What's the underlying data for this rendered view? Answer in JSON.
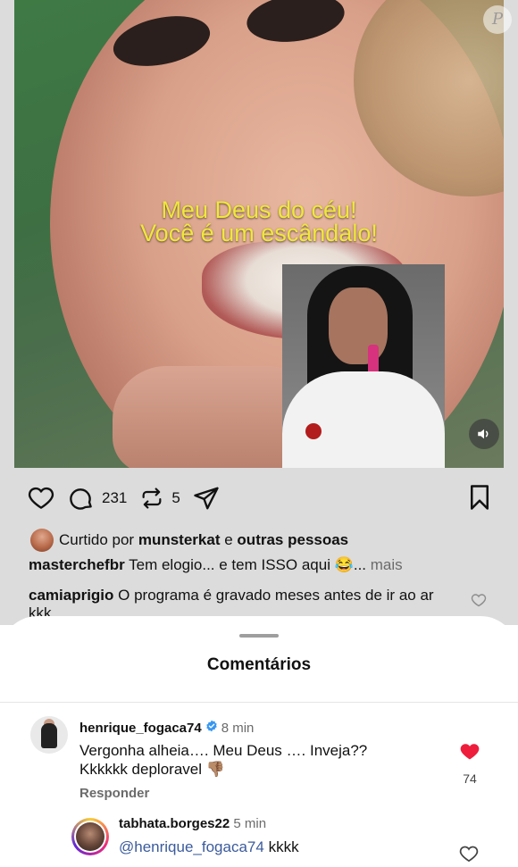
{
  "video": {
    "caption_line1": "Meu Deus do céu!",
    "caption_line2": "Você é um escândalo!",
    "watermark_letter": "P",
    "sound_icon": "speaker-icon"
  },
  "actions": {
    "comments_count": "231",
    "reposts_count": "5"
  },
  "post": {
    "liked_prefix": "Curtido por",
    "liked_user": "munsterkat",
    "liked_and": "e",
    "liked_others": "outras pessoas",
    "author": "masterchefbr",
    "caption_text": "Tem elogio... e tem ISSO aqui 😂...",
    "more_label": "mais",
    "preview_comment_user": "camiaprigio",
    "preview_comment_text": "O programa é gravado meses antes de ir ao ar kkk"
  },
  "sheet": {
    "title": "Comentários"
  },
  "comments": [
    {
      "username": "henrique_fogaca74",
      "time": "8 min",
      "text": "Vergonha alheia…. Meu Deus …. Inveja?? Kkkkkk deploravel 👎🏽",
      "likes": "74",
      "reply_label": "Responder"
    },
    {
      "username": "tabhata.borges22",
      "time": "5 min",
      "mention": "@henrique_fogaca74",
      "text": "kkkk"
    }
  ],
  "colors": {
    "like_red": "#ee1d3c",
    "caption_yellow": "#f0e83a",
    "mention_blue": "#3b5b9c"
  }
}
